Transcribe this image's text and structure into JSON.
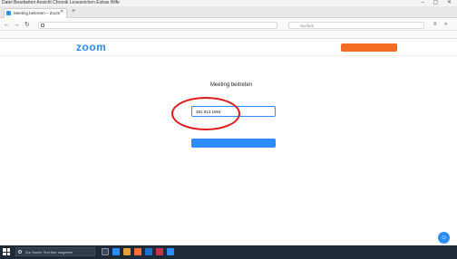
{
  "browser": {
    "menu_text": "Datei  Bearbeiten  Ansicht  Chronik  Lesezeichen  Extras  Hilfe",
    "window_controls": "–  ▢  ✕",
    "tab_title": "Meeting beitreten – Zoom",
    "tab_close": "✕",
    "tab_new": "+",
    "back": "←",
    "forward": "→",
    "reload": "↻",
    "address": "",
    "search_placeholder": "Suchen",
    "bookmarks_text": ""
  },
  "header": {
    "logo": "zoom",
    "links": [
      "",
      "",
      ""
    ],
    "signup": ""
  },
  "join": {
    "title": "Meeting beitreten",
    "field_label": "",
    "meeting_id_value": "381 913 1994",
    "terms_text": "",
    "join_button": "",
    "room_text": ""
  },
  "footer": {
    "text": ""
  },
  "help_fab_icon": "☺",
  "taskbar": {
    "search_placeholder": "Zur Suche Text hier eingeben",
    "tray_text": "",
    "time": "",
    "date": ""
  },
  "colors": {
    "zoom_blue": "#2d8cff",
    "signup_orange": "#f26d21",
    "annotation_red": "#e01a1a",
    "taskbar": "#1e2a38"
  }
}
